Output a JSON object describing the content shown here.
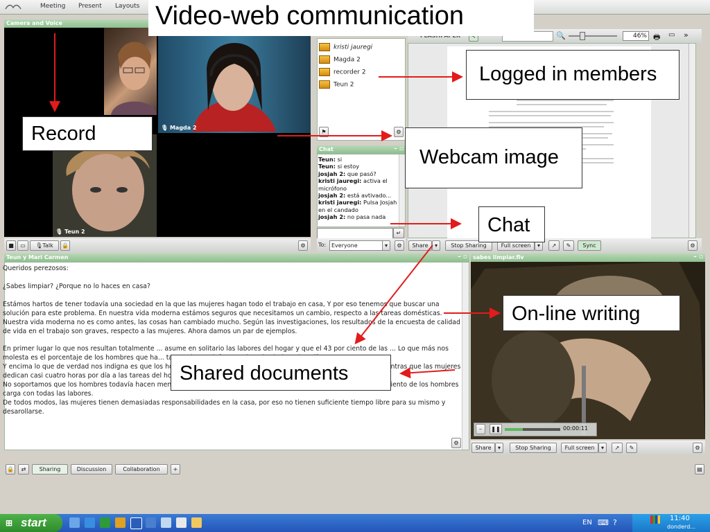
{
  "slide_title": "Video-web communication",
  "menubar": {
    "items": [
      "Meeting",
      "Present",
      "Layouts"
    ]
  },
  "camera_pod": {
    "title": "Camera and Voice",
    "participants": [
      {
        "name": "Magda 2"
      },
      {
        "name": "Teun 2"
      }
    ],
    "talk_label": "Talk"
  },
  "attendees": {
    "list": [
      "kristi jauregi",
      "Magda 2",
      "recorder 2",
      "Teun 2"
    ]
  },
  "flashpaper": {
    "brand": "FLASHPAPER",
    "zoom": "46%"
  },
  "chat": {
    "title": "Chat",
    "messages": [
      {
        "author": "Teun:",
        "text": "si"
      },
      {
        "author": "Teun:",
        "text": "si estoy"
      },
      {
        "author": "josjah 2:",
        "text": "que pasó?"
      },
      {
        "author": "kristi jauregi:",
        "text": "activa el micrófono"
      },
      {
        "author": "josjah 2:",
        "text": "está avtivado..."
      },
      {
        "author": "kristi jauregi:",
        "text": "Pulsa Josjah en el candado"
      },
      {
        "author": "josjah 2:",
        "text": "no pasa nada"
      }
    ],
    "to_label": "To:",
    "recipient": "Everyone"
  },
  "share_toolbar": {
    "share": "Share",
    "stop": "Stop Sharing",
    "fullscreen": "Full screen",
    "sync": "Sync"
  },
  "notes_pod": {
    "title": "Teun y Mari Carmen",
    "paragraphs": [
      "Queridos perezosos:",
      "¿Sabes limpiar? ¿Porque no lo haces en casa?",
      "Estámos hartos de tener todavía una sociedad en la que las mujeres hagan todo el trabajo en casa, Y por eso tenemos que buscar una solución para este problema. En nuestra vida moderna estámos seguros que necesitamos un cambio, respecto a las tareas domésticas. Nuestra vida moderna no es como antes, las cosas han cambiado mucho. Según las investigaciones, los resultados de la encuesta de calidad de vida en el trabajo son graves, respecto a las mujeres. Ahora damos un par de ejemplos.",
      "En primer lugar lo que nos resultan totalmente ... asume en solitario las labores del hogar y que el 43 por ciento de las ... Lo que más nos molesta es el porcentaje de los hombres que ha... tareas domesticás, por ejemplo ciudar a los niños. Que...\nY encima lo que de verdad nos indigna es que los hombres invierten solamente 44 minutos en las tareas del hogar, mientras que las mujeres dedican casi cuatro horas por día a las tareas del hogar también.\nNo soportamos que los hombres todavía hacen menos cuando hay hijos a cargo. Según las estadísticas solo el 1.5 por ciento de los hombres carga con todas las labores.\nDe todos modos, las mujeres tienen demasiadas responsabilidades en la casa, por eso no tienen suficiente tiempo libre para su mismo y desarollarse."
    ]
  },
  "video_pod": {
    "title": "sabes limpiar.flv",
    "time": "00:00:11",
    "progress": 0.33
  },
  "bottom_tabs": [
    "Sharing",
    "Discussion",
    "Collaboration"
  ],
  "callouts": {
    "record": "Record",
    "logged_in": "Logged in members",
    "webcam": "Webcam image",
    "chat": "Chat",
    "online_writing": "On-line writing",
    "shared_docs": "Shared documents"
  },
  "taskbar": {
    "start": "start",
    "lang": "EN",
    "clock": "11:40",
    "day": "donderd..."
  },
  "colors": {
    "pod_header": "#a8cca8",
    "callout_arrow": "#e21b1b",
    "taskbar": "#245edb",
    "start_green": "#3c9d36"
  }
}
